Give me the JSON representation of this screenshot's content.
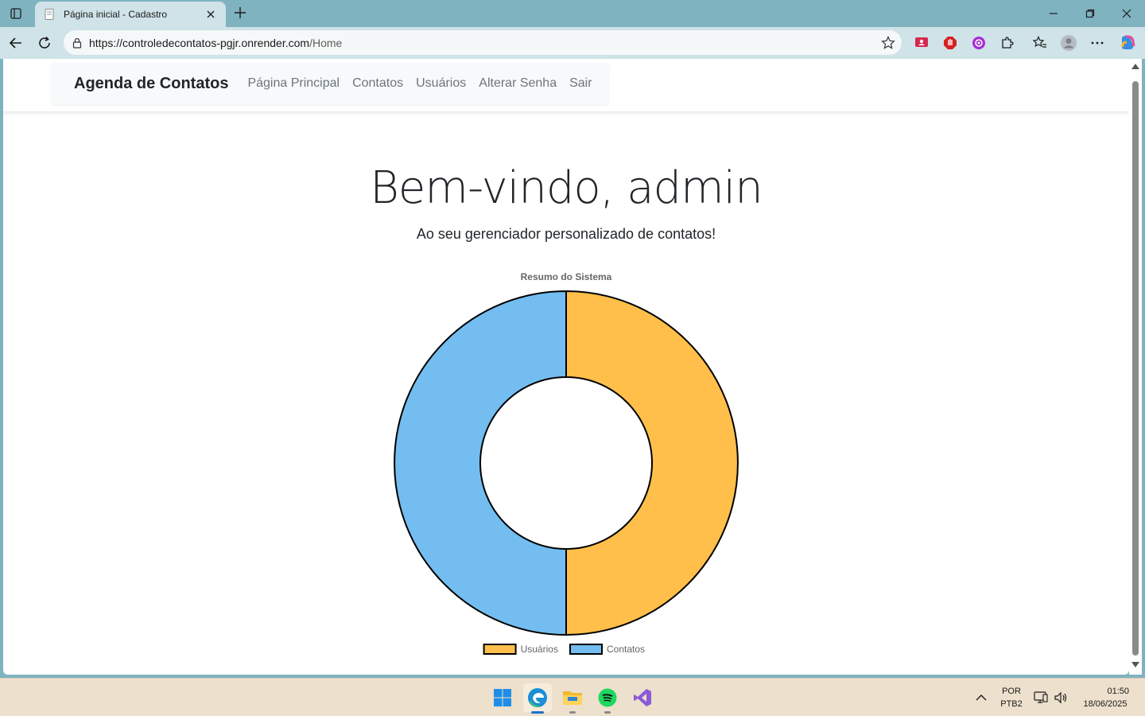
{
  "browser": {
    "tab_title": "Página inicial - Cadastro",
    "url_host": "https://controledecontatos-pgjr.onrender.com",
    "url_path": "/Home"
  },
  "site": {
    "brand": "Agenda de Contatos",
    "nav": [
      "Página Principal",
      "Contatos",
      "Usuários",
      "Alterar Senha",
      "Sair"
    ]
  },
  "hero": {
    "title": "Bem-vindo, admin",
    "subtitle": "Ao seu gerenciador personalizado de contatos!"
  },
  "chart_data": {
    "type": "pie",
    "variant": "doughnut",
    "title": "Resumo do Sistema",
    "categories": [
      "Usuários",
      "Contatos"
    ],
    "values": [
      1,
      1
    ],
    "colors": [
      "#ffbf4a",
      "#73bdf0"
    ],
    "legend": "bottom"
  },
  "taskbar": {
    "lang": "POR",
    "layout": "PTB2",
    "time": "01:50",
    "date": "18/06/2025"
  }
}
